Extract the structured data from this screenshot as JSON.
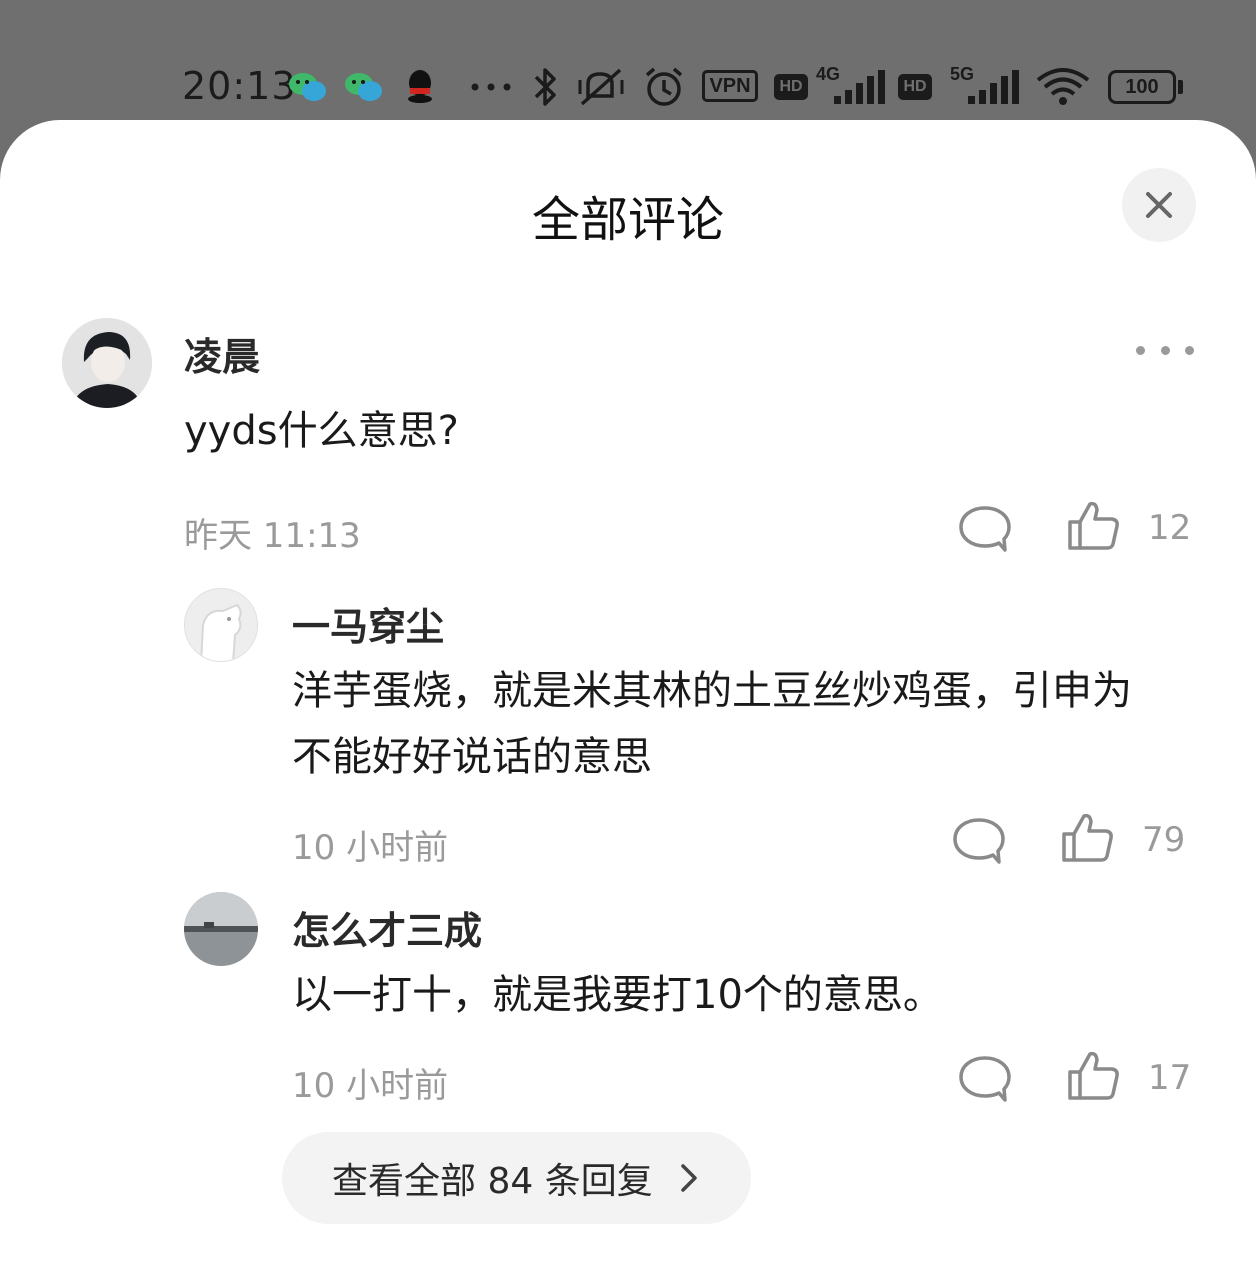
{
  "status_bar": {
    "time": "20:13",
    "vpn_label": "VPN",
    "hd_label": "HD",
    "net1": "4G",
    "net2": "5G",
    "battery": "100",
    "icons": [
      "wechat-icon",
      "wechat-icon",
      "qq-icon",
      "more-dots-icon",
      "bluetooth-icon",
      "vibrate-off-icon",
      "alarm-icon",
      "vpn-icon",
      "hd-icon",
      "signal-icon",
      "hd-icon",
      "signal-icon",
      "wifi-icon",
      "battery-icon"
    ]
  },
  "sheet": {
    "title": "全部评论",
    "close_icon": "close-icon"
  },
  "comment": {
    "author": "凌晨",
    "text": "yyds什么意思?",
    "time": "昨天 11:13",
    "likes": "12"
  },
  "replies": [
    {
      "author": "一马穿尘",
      "text_line1": "洋芋蛋烧，就是米其林的土豆丝炒鸡蛋，引申为",
      "text_line2": "不能好好说话的意思",
      "time": "10 小时前",
      "likes": "79"
    },
    {
      "author": "怎么才三成",
      "text_line1": "以一打十，就是我要打10个的意思。",
      "time": "10 小时前",
      "likes": "17"
    }
  ],
  "view_all": {
    "label": "查看全部 84 条回复"
  },
  "colors": {
    "status_bg": "#6f6f6f",
    "sheet_bg": "#ffffff",
    "meta_gray": "#9a9a9a",
    "pill_bg": "#f3f3f3"
  }
}
